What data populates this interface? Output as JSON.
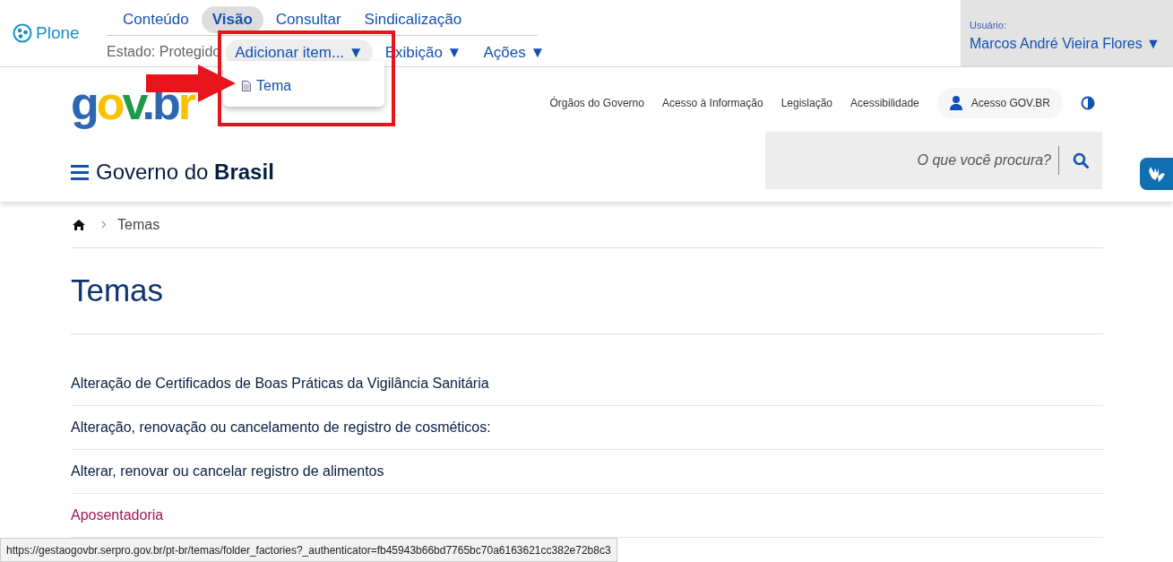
{
  "toolbar": {
    "logo": "Plone",
    "tabs": [
      {
        "label": "Conteúdo",
        "selected": false
      },
      {
        "label": "Visão",
        "selected": true
      },
      {
        "label": "Consultar",
        "selected": false
      },
      {
        "label": "Sindicalização",
        "selected": false
      }
    ],
    "state_label": "Estado: Protegido",
    "menus": [
      {
        "label": "Adicionar item... ▼",
        "open": true
      },
      {
        "label": "Exibição ▼",
        "open": false
      },
      {
        "label": "Ações ▼",
        "open": false
      }
    ],
    "user": {
      "label": "Usuário:",
      "name": "Marcos André Vieira Flores ▼"
    }
  },
  "dropdown": {
    "items": [
      {
        "label": "Tema"
      }
    ]
  },
  "header": {
    "logo": "gov.br",
    "links": [
      "Órgãos do Governo",
      "Acesso à Informação",
      "Legislação",
      "Acessibilidade"
    ],
    "login_button": "Acesso GOV.BR",
    "brand": {
      "prefix": "Governo do",
      "bold": "Brasil"
    },
    "search": {
      "placeholder": "O que você procura?"
    }
  },
  "breadcrumb": [
    "Temas"
  ],
  "page_title": "Temas",
  "items": [
    {
      "label": "Alteração de Certificados de Boas Práticas da Vigilância Sanitária",
      "visited": false
    },
    {
      "label": "Alteração, renovação ou cancelamento de registro de cosméticos:",
      "visited": false
    },
    {
      "label": "Alterar, renovar ou cancelar registro de alimentos",
      "visited": false
    },
    {
      "label": "Aposentadoria",
      "visited": true
    }
  ],
  "status_bar": {
    "url": "https://gestaogovbr.serpro.gov.br/pt-br/temas/folder_factories?_authenticator=fb45943b66bd7765bc70a6163621cc382e72b8c3"
  }
}
